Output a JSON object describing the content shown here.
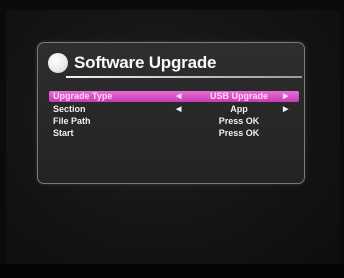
{
  "dialog": {
    "title": "Software Upgrade",
    "rows": [
      {
        "label": "Upgrade Type",
        "value": "USB Upgrade",
        "has_arrows": true,
        "selected": true
      },
      {
        "label": "Section",
        "value": "App",
        "has_arrows": true,
        "selected": false
      },
      {
        "label": "File Path",
        "value": "Press OK",
        "has_arrows": false,
        "selected": false
      },
      {
        "label": "Start",
        "value": "Press OK",
        "has_arrows": false,
        "selected": false
      }
    ],
    "icons": {
      "left": "arrow-left-icon",
      "right": "arrow-right-icon"
    }
  },
  "colors": {
    "highlight": "#d24fbf",
    "panel_background": "#2a2a2a",
    "text": "#f0f0f0"
  }
}
